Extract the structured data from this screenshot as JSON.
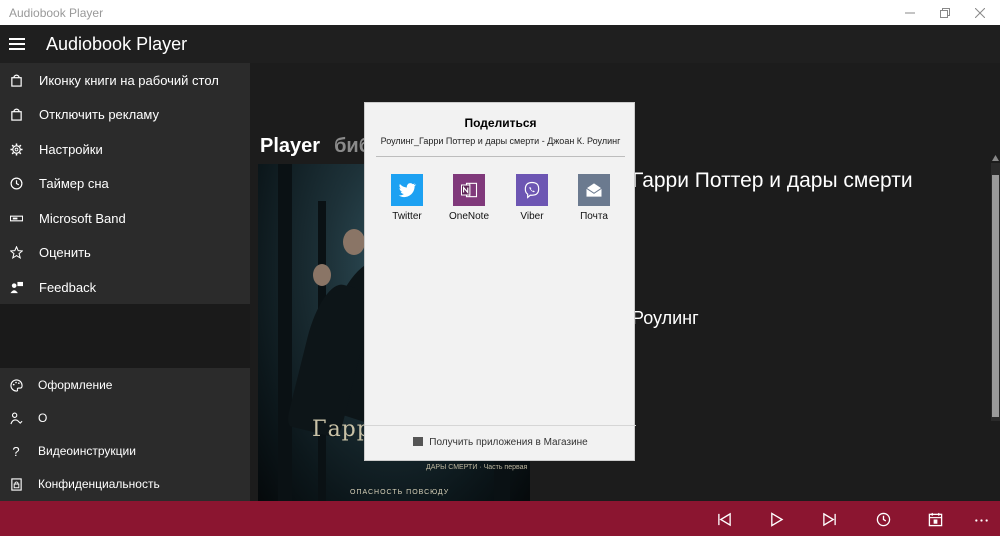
{
  "window": {
    "title": "Audiobook Player"
  },
  "app": {
    "title": "Audiobook Player"
  },
  "menu": {
    "items": [
      {
        "label": "Иконку книги на рабочий стол",
        "icon": "bag-icon"
      },
      {
        "label": "Отключить рекламу",
        "icon": "bag-icon"
      },
      {
        "label": "Настройки",
        "icon": "gear-icon"
      },
      {
        "label": "Таймер сна",
        "icon": "clock-icon"
      },
      {
        "label": "Microsoft Band",
        "icon": "band-icon"
      },
      {
        "label": "Оценить",
        "icon": "star-icon"
      },
      {
        "label": "Feedback",
        "icon": "feedback-icon"
      }
    ],
    "bottom_items": [
      {
        "label": "Оформление",
        "icon": "palette-icon"
      },
      {
        "label": "О",
        "icon": "person-icon"
      },
      {
        "label": "Видеоинструкции",
        "icon": "help-icon"
      },
      {
        "label": "Конфиденциальность",
        "icon": "privacy-icon"
      }
    ]
  },
  "tabs": {
    "player": "Player",
    "library": "биб"
  },
  "book": {
    "title": "Гарри Поттер и дары смерти",
    "author": "Роулинг",
    "cover": {
      "title": "Гарри",
      "subtitle": "ДАРЫ СМЕРТИ · Часть первая",
      "tagline": "ОПАСНОСТЬ ПОВСЮДУ"
    }
  },
  "share": {
    "title": "Поделиться",
    "subtitle": "Роулинг_Гарри Поттер и дары смерти - Джоан К. Роулинг",
    "targets": [
      {
        "label": "Twitter",
        "icon": "twitter-icon",
        "color": "#1da1f2"
      },
      {
        "label": "OneNote",
        "icon": "onenote-icon",
        "color": "#80397b"
      },
      {
        "label": "Viber",
        "icon": "viber-icon",
        "color": "#6d56b3"
      },
      {
        "label": "Почта",
        "icon": "mail-icon",
        "color": "#6b7a8f"
      }
    ],
    "store_link": "Получить приложения в Магазине"
  },
  "player": {
    "accent": "#8b1530",
    "buttons": [
      "previous-icon",
      "play-icon",
      "next-icon",
      "timer-icon",
      "calendar-icon",
      "more-icon"
    ]
  }
}
